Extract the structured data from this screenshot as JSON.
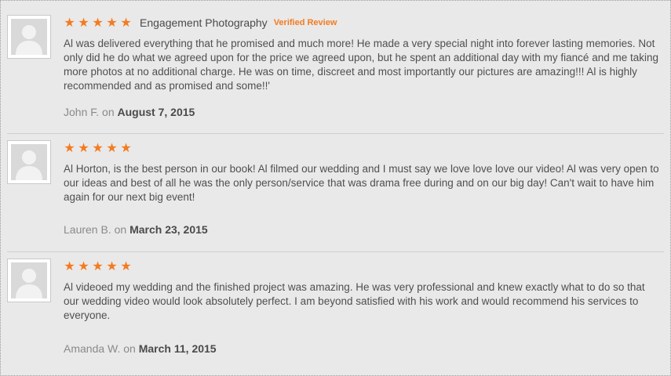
{
  "reviews": [
    {
      "stars": [
        "★",
        "★",
        "★",
        "★",
        "★"
      ],
      "category": "Engagement Photography",
      "verified_label": "Verified Review",
      "text": "Al was delivered everything that he promised and much more! He made a very special night into forever lasting memories. Not only did he do what we agreed upon for the price we agreed upon, but he spent an additional day with my fiancé and me taking more photos at no additional charge. He was on time, discreet and most importantly our pictures are amazing!!! Al is highly recommended and as promised and some!!'",
      "author": "John F.",
      "on_label": "on",
      "date": "August 7, 2015"
    },
    {
      "stars": [
        "★",
        "★",
        "★",
        "★",
        "★"
      ],
      "text": "Al Horton, is the best person in our book! Al filmed our wedding and I must say we love love love our video! Al was very open to our ideas and best of all he was the only person/service that was drama free during and on our big day! Can't wait to have him again for our next big event!",
      "author": "Lauren B.",
      "on_label": "on",
      "date": "March 23, 2015"
    },
    {
      "stars": [
        "★",
        "★",
        "★",
        "★",
        "★"
      ],
      "text": "Al videoed my wedding and the finished project was amazing. He was very professional and knew exactly what to do so that our wedding video would look absolutely perfect. I am beyond satisfied with his work and would recommend his services to everyone.",
      "author": "Amanda W.",
      "on_label": "on",
      "date": "March 11, 2015"
    }
  ],
  "colors": {
    "star": "#f47b20",
    "verified": "#f47b20",
    "background": "#e9e9e9",
    "text": "#4f4f4f",
    "byline": "#8a8a8a"
  },
  "icons": {
    "avatar": "user-silhouette-icon",
    "star": "star-icon"
  }
}
